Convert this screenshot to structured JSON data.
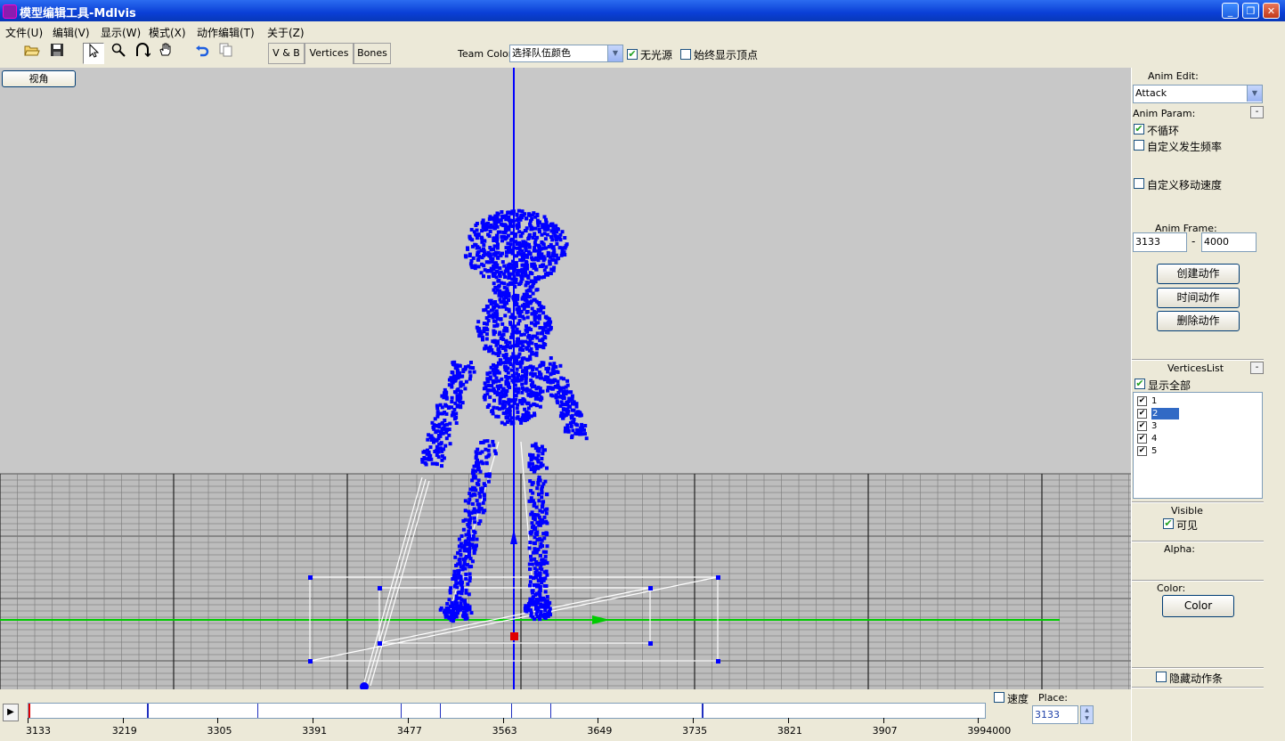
{
  "window": {
    "title": "模型编辑工具-Mdlvis",
    "min_symbol": "_",
    "max_symbol": "❐",
    "close_symbol": "✕"
  },
  "menu": [
    "文件(U)",
    "编辑(V)",
    "显示(W)",
    "模式(X)",
    "动作编辑(T)",
    "关于(Z)"
  ],
  "toolbar": {
    "icons": [
      "open-icon",
      "save-icon",
      "pointer-icon",
      "zoom-icon",
      "rotate-icon",
      "hand-icon",
      "undo-icon",
      "copy-icon"
    ],
    "tabs": {
      "vb": "V & B",
      "vertices": "Vertices",
      "bones": "Bones"
    },
    "team_color_label": "Team Color",
    "team_color_value": "选择队伍颜色",
    "no_light_label": "无光源",
    "no_light_checked": true,
    "always_show_vertices_label": "始终显示顶点",
    "always_show_vertices_checked": false
  },
  "viewport": {
    "view_button": "视角"
  },
  "panel": {
    "anim_edit_label": "Anim Edit:",
    "anim_select": "Attack",
    "anim_param_label": "Anim Param:",
    "collapse_symbol": "-",
    "no_loop_label": "不循环",
    "no_loop_checked": true,
    "custom_rarity_label": "自定义发生频率",
    "custom_rarity_checked": false,
    "custom_move_speed_label": "自定义移动速度",
    "custom_move_speed_checked": false,
    "anim_frame_label": "Anim Frame:",
    "frame_start": "3133",
    "frame_dash": "-",
    "frame_end": "4000",
    "create_anim_button": "创建动作",
    "time_anim_button": "时间动作",
    "delete_anim_button": "删除动作",
    "vertices_list_label": "VerticesList",
    "show_all_label": "显示全部",
    "show_all_checked": true,
    "vertex_groups": [
      {
        "label": "1",
        "checked": true,
        "selected": false
      },
      {
        "label": "2",
        "checked": true,
        "selected": true
      },
      {
        "label": "3",
        "checked": true,
        "selected": false
      },
      {
        "label": "4",
        "checked": true,
        "selected": false
      },
      {
        "label": "5",
        "checked": true,
        "selected": false
      }
    ],
    "visible_label": "Visible",
    "visible_checkbox_label": "可见",
    "visible_checked": true,
    "alpha_label": "Alpha:",
    "color_label": "Color:",
    "color_button": "Color",
    "hide_timeline_label": "隐藏动作条",
    "hide_timeline_checked": false
  },
  "timeline": {
    "start": 3133,
    "end": 4000,
    "current": 3133,
    "tick_labels": [
      "3133",
      "3219",
      "3305",
      "3391",
      "3477",
      "3563",
      "3649",
      "3735",
      "3821",
      "3907",
      "3994000"
    ],
    "tick_frames": [
      3133,
      3219,
      3305,
      3391,
      3477,
      3563,
      3649,
      3735,
      3821,
      3907,
      3993
    ],
    "keyframes": [
      3133,
      3240,
      3340,
      3470,
      3505,
      3570,
      3605,
      3742
    ],
    "thick_keyframes": [
      3240,
      3742
    ],
    "speed_label": "速度",
    "speed_checked": false,
    "place_label": "Place:",
    "place_value": "3133"
  },
  "colors": {
    "model": "#0000ff",
    "grid_bg": "#c8c8c8",
    "x_axis": "#00cc00",
    "pivot": "#e00000",
    "bone_lines": "#ffffff"
  }
}
